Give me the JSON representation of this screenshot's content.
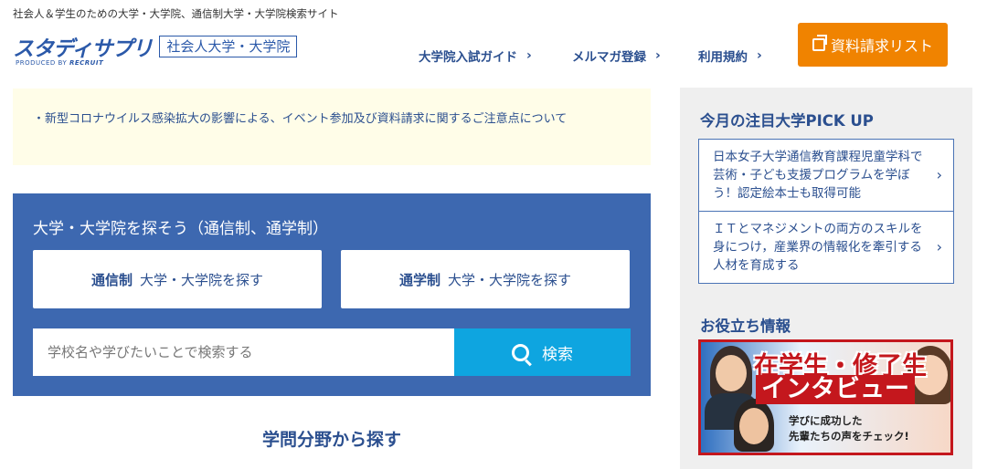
{
  "header": {
    "tagline": "社会人＆学生のための大学・大学院、通信制大学・大学院検索サイト",
    "logo_main": "スタディサプリ",
    "logo_sub": "社会人大学・大学院",
    "produced_by": "PRODUCED BY",
    "produced_brand": "RECRUIT",
    "nav": [
      {
        "label": "大学院入試ガイド",
        "chevron": "›"
      },
      {
        "label": "メルマガ登録",
        "chevron": "›"
      },
      {
        "label": "利用規約",
        "chevron": "›"
      }
    ],
    "request_button": {
      "label": "資料請求リスト",
      "icon": "copy-icon"
    }
  },
  "notice": {
    "text": "・新型コロナウイルス感染拡大の影響による、イベント参加及び資料請求に関するご注意点について"
  },
  "search": {
    "title": "大学・大学院を探そう（通信制、通学制）",
    "correspondence": {
      "bold": "通信制",
      "label": "大学・大学院を探す"
    },
    "commuting": {
      "bold": "通学制",
      "label": "大学・大学院を探す"
    },
    "placeholder": "学校名や学びたいことで検索する",
    "search_label": "検索",
    "search_icon": "magnifier-icon"
  },
  "main": {
    "section_heading": "学問分野から探す"
  },
  "sidebar": {
    "pickup_title": "今月の注目大学PICK UP",
    "pickups": [
      {
        "text": "日本女子大学通信教育課程児童学科で芸術・子ども支援プログラムを学ぼう！認定絵本士も取得可能",
        "arrow": "›"
      },
      {
        "text": "ＩＴとマネジメントの両方のスキルを身につけ，産業界の情報化を牽引する人材を育成する",
        "arrow": "›"
      }
    ],
    "info_title": "お役立ち情報",
    "banner": {
      "line1": "在学生・修了生",
      "line2": "インタビュー",
      "line3": "学びに成功した",
      "line4": "先輩たちの声をチェック!"
    }
  },
  "colors": {
    "brand_blue": "#2b59a9",
    "panel_blue": "#3d68b0",
    "search_cyan": "#0ea5e0",
    "orange": "#f08300",
    "banner_red": "#c4171d"
  }
}
